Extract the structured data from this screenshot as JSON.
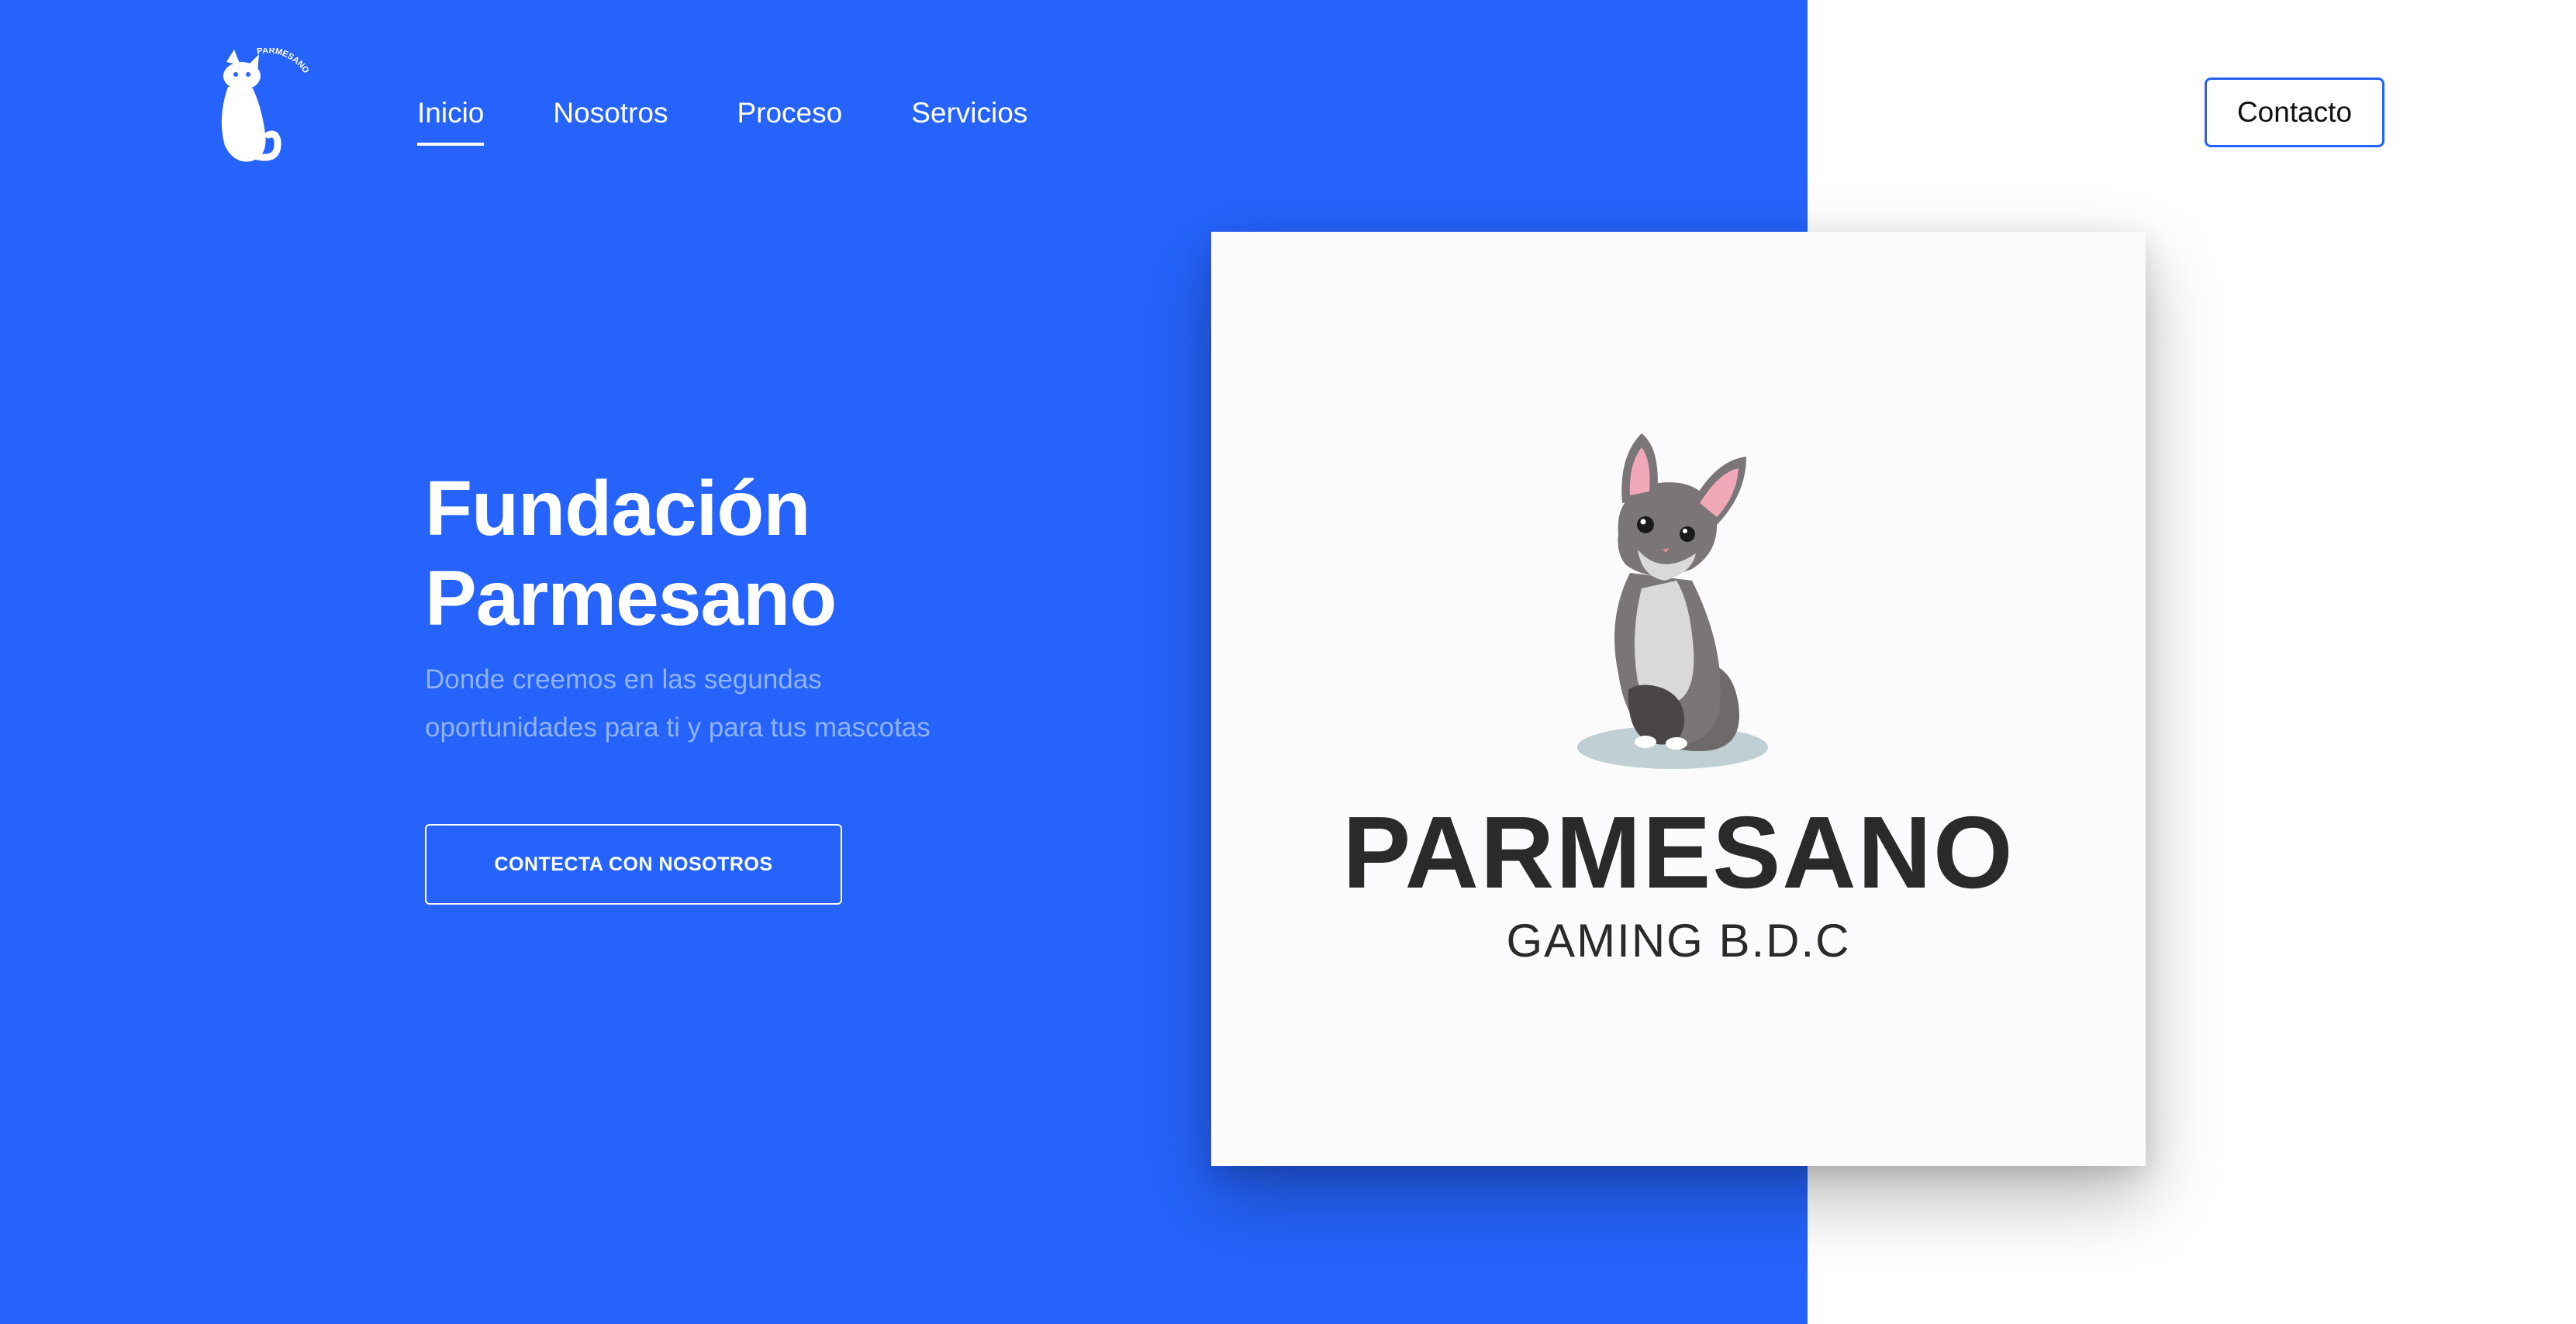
{
  "logo": {
    "text": "PARMESANO",
    "icon": "cat-logo-icon"
  },
  "nav": {
    "items": [
      {
        "label": "Inicio",
        "active": true
      },
      {
        "label": "Nosotros",
        "active": false
      },
      {
        "label": "Proceso",
        "active": false
      },
      {
        "label": "Servicios",
        "active": false
      }
    ]
  },
  "header": {
    "contact_label": "Contacto"
  },
  "hero": {
    "title_line1": "Fundación",
    "title_line2": "Parmesano",
    "subtitle_line1": "Donde creemos en las segundas",
    "subtitle_line2": "oportunidades para ti y para tus mascotas",
    "cta_label": "CONTECTA CON NOSOTROS"
  },
  "card": {
    "brand": "PARMESANO",
    "tagline": "GAMING B.D.C",
    "illustration": "chinchilla-illustration"
  },
  "colors": {
    "primary_blue": "#2563fb",
    "subtitle_blue": "#8fb3fb",
    "white": "#ffffff",
    "brand_dark": "#2a2a2a"
  }
}
